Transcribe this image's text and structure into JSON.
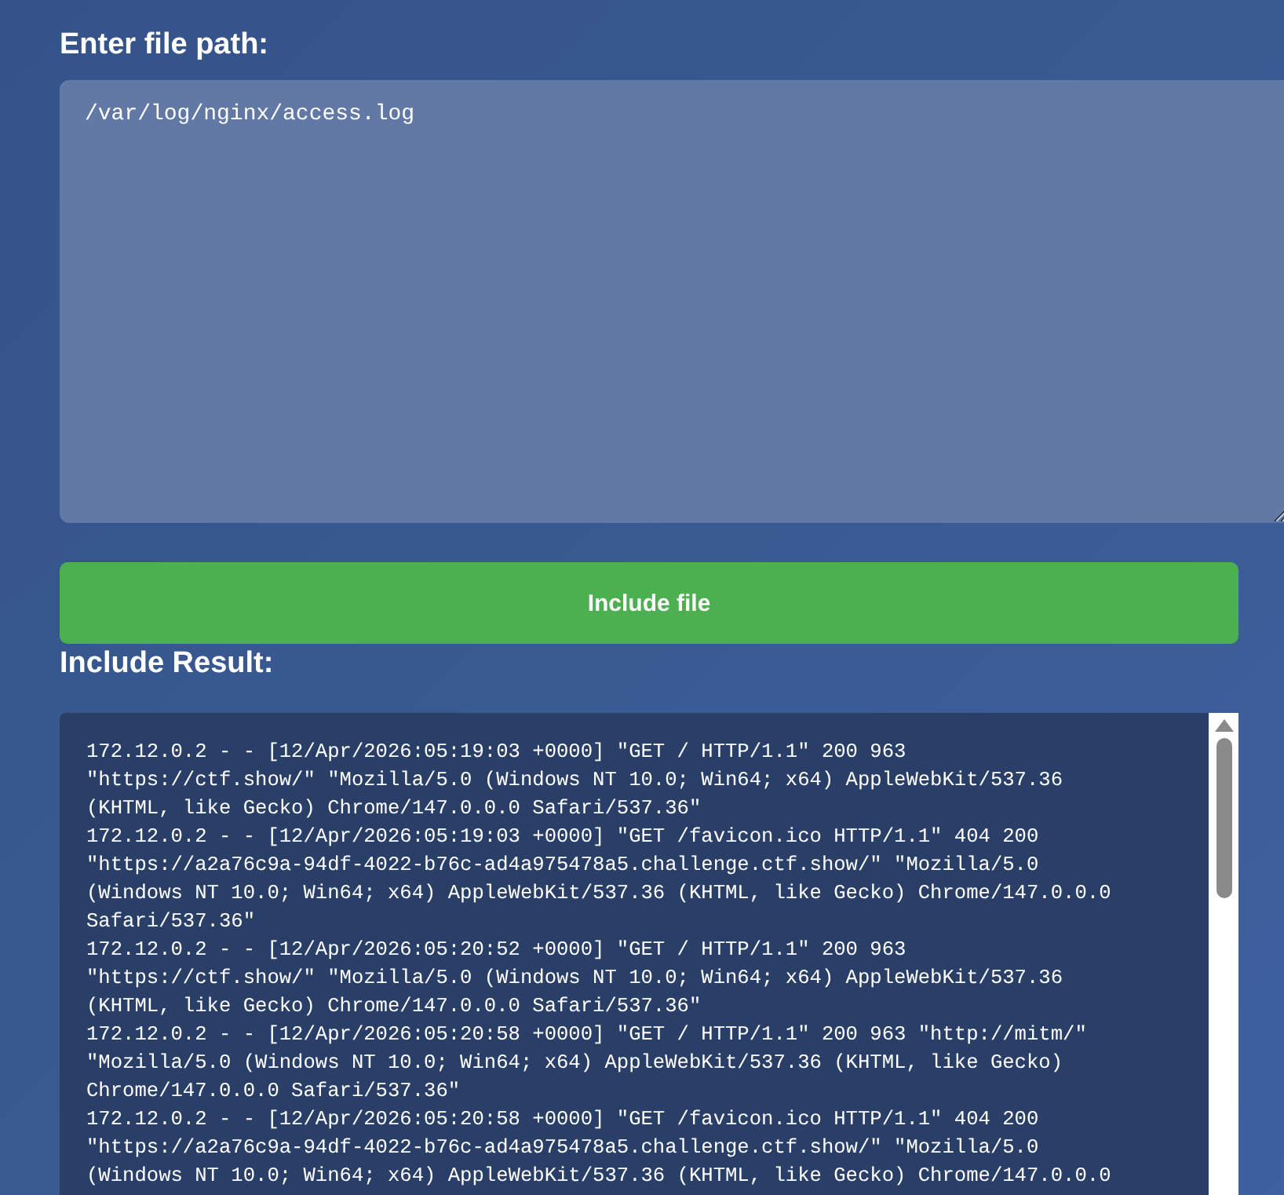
{
  "path_form": {
    "heading": "Enter file path:",
    "path_field": {
      "value": "/var/log/nginx/access.log"
    },
    "submit_button": "Include file"
  },
  "result": {
    "heading": "Include Result:",
    "lines": [
      "172.12.0.2 - - [12/Apr/2026:05:19:03 +0000] \"GET / HTTP/1.1\" 200 963",
      "\"https://ctf.show/\" \"Mozilla/5.0 (Windows NT 10.0; Win64; x64) AppleWebKit/537.36",
      "(KHTML, like Gecko) Chrome/147.0.0.0 Safari/537.36\"",
      "172.12.0.2 - - [12/Apr/2026:05:19:03 +0000] \"GET /favicon.ico HTTP/1.1\" 404 200",
      "\"https://a2a76c9a-94df-4022-b76c-ad4a975478a5.challenge.ctf.show/\" \"Mozilla/5.0",
      "(Windows NT 10.0; Win64; x64) AppleWebKit/537.36 (KHTML, like Gecko) Chrome/147.0.0.0",
      "Safari/537.36\"",
      "172.12.0.2 - - [12/Apr/2026:05:20:52 +0000] \"GET / HTTP/1.1\" 200 963",
      "\"https://ctf.show/\" \"Mozilla/5.0 (Windows NT 10.0; Win64; x64) AppleWebKit/537.36",
      "(KHTML, like Gecko) Chrome/147.0.0.0 Safari/537.36\"",
      "172.12.0.2 - - [12/Apr/2026:05:20:58 +0000] \"GET / HTTP/1.1\" 200 963 \"http://mitm/\"",
      "\"Mozilla/5.0 (Windows NT 10.0; Win64; x64) AppleWebKit/537.36 (KHTML, like Gecko)",
      "Chrome/147.0.0.0 Safari/537.36\"",
      "172.12.0.2 - - [12/Apr/2026:05:20:58 +0000] \"GET /favicon.ico HTTP/1.1\" 404 200",
      "\"https://a2a76c9a-94df-4022-b76c-ad4a975478a5.challenge.ctf.show/\" \"Mozilla/5.0",
      "(Windows NT 10.0; Win64; x64) AppleWebKit/537.36 (KHTML, like Gecko) Chrome/147.0.0.0"
    ]
  }
}
